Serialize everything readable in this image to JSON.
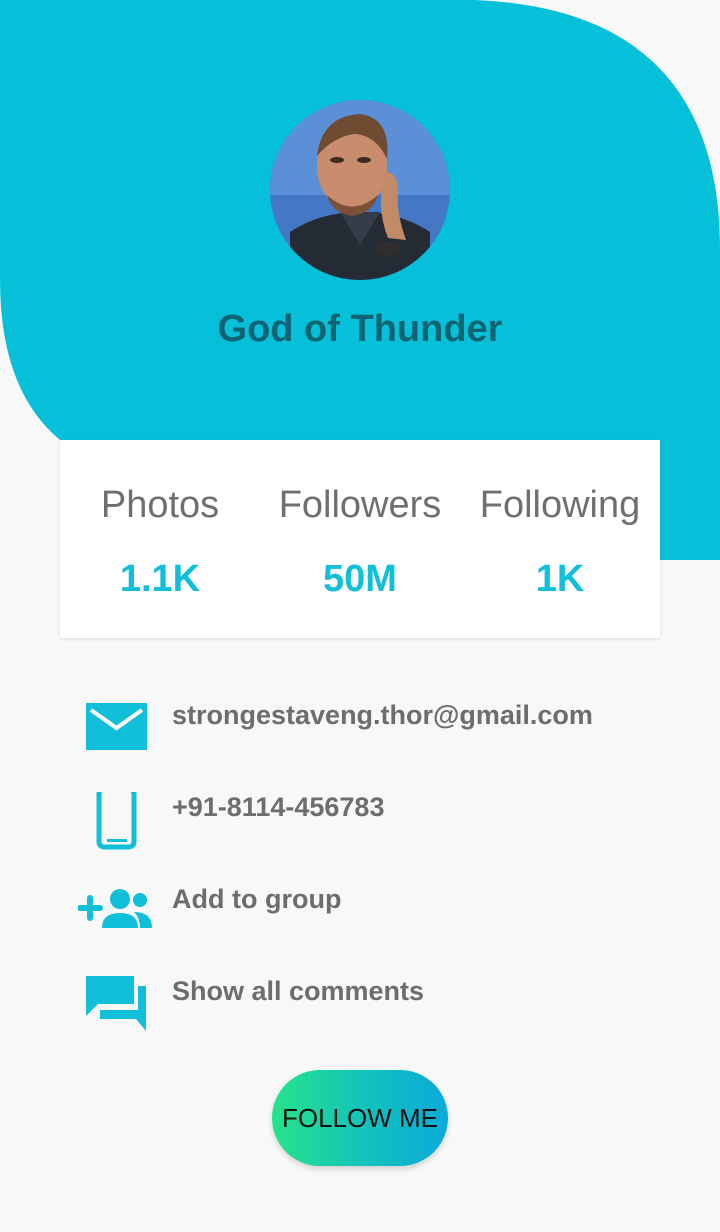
{
  "colors": {
    "accent": "#06c0d9",
    "name_text": "#0d6574",
    "stat_value": "#11bfd8",
    "secondary_text": "#6d6d6d",
    "button_gradient_start": "#26e38b",
    "button_gradient_end": "#0aa9da"
  },
  "profile": {
    "name": "God of Thunder",
    "avatar_icon": "profile-photo"
  },
  "stats": [
    {
      "label": "Photos",
      "value": "1.1K"
    },
    {
      "label": "Followers",
      "value": "50M"
    },
    {
      "label": "Following",
      "value": "1K"
    }
  ],
  "info": [
    {
      "icon": "mail-icon",
      "text": "strongestaveng.thor@gmail.com"
    },
    {
      "icon": "phone-icon",
      "text": "+91-8114-456783"
    },
    {
      "icon": "add-group-icon",
      "text": "Add to group"
    },
    {
      "icon": "comments-icon",
      "text": "Show all comments"
    }
  ],
  "actions": {
    "follow_label": "FOLLOW ME"
  }
}
